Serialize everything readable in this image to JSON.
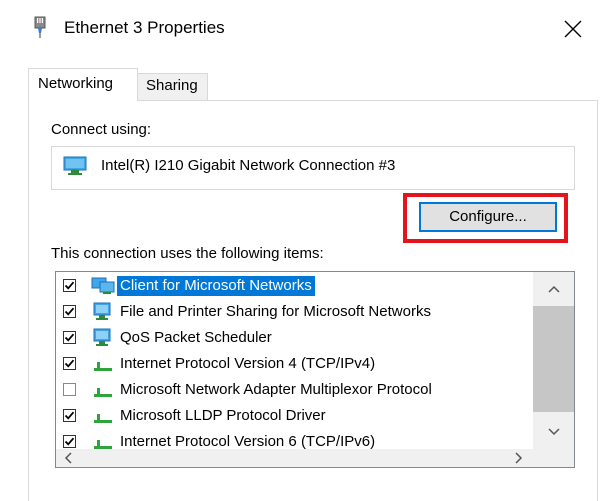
{
  "window": {
    "title": "Ethernet 3 Properties"
  },
  "tabs": [
    {
      "label": "Networking"
    },
    {
      "label": "Sharing"
    }
  ],
  "connect_using": {
    "label": "Connect using:",
    "adapter": "Intel(R) I210 Gigabit Network Connection #3",
    "configure_label": "Configure..."
  },
  "items_section": {
    "label": "This connection uses the following items:",
    "items": [
      {
        "label": "Client for Microsoft Networks",
        "checked": true,
        "selected": true,
        "icon": "network-client-icon"
      },
      {
        "label": "File and Printer Sharing for Microsoft Networks",
        "checked": true,
        "selected": false,
        "icon": "network-service-icon"
      },
      {
        "label": "QoS Packet Scheduler",
        "checked": true,
        "selected": false,
        "icon": "network-service-icon"
      },
      {
        "label": "Internet Protocol Version 4 (TCP/IPv4)",
        "checked": true,
        "selected": false,
        "icon": "protocol-icon"
      },
      {
        "label": "Microsoft Network Adapter Multiplexor Protocol",
        "checked": false,
        "selected": false,
        "icon": "protocol-icon"
      },
      {
        "label": "Microsoft LLDP Protocol Driver",
        "checked": true,
        "selected": false,
        "icon": "protocol-icon"
      },
      {
        "label": "Internet Protocol Version 6 (TCP/IPv6)",
        "checked": true,
        "selected": false,
        "icon": "protocol-icon"
      }
    ]
  },
  "colors": {
    "accent": "#0078d7",
    "highlight_box": "#e3141c",
    "protocol_green": "#2fa33c"
  }
}
